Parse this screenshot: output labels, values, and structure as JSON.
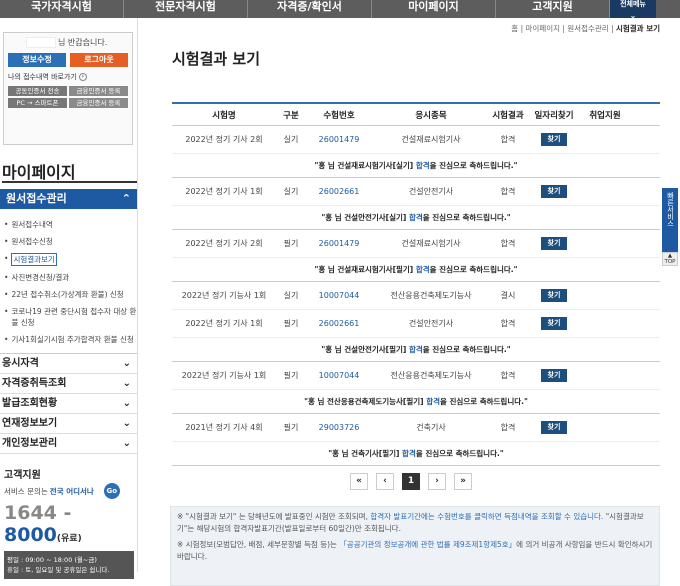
{
  "topnav": [
    "국가자격시험",
    "전문자격시험",
    "자격증/확인서",
    "마이페이지",
    "고객지원",
    "전체메뉴"
  ],
  "login": {
    "greeting": "님 반갑습니다.",
    "edit": "정보수정",
    "logout": "로그아웃",
    "shortcut": "나의 접수내역 바로가기",
    "btn1": "공동인증서 전송",
    "btn2": "금융인증서 등록",
    "btn3": "PC → 스마트폰",
    "btn4": "금융인증서 등록"
  },
  "sidebar": {
    "title": "마이페이지",
    "section": "원서접수관리",
    "items": [
      "원서접수내역",
      "원서접수신청",
      "시험결과보기",
      "사진변경신청/결과",
      "22년 접수취소(가상계좌 환불) 신청",
      "코로나19 관련 중단시험 접수자 대상 환불 신청",
      "기사1회실기시험 추가합격자 환불 신청"
    ],
    "menus": [
      "응시자격",
      "자격증취득조회",
      "발급조회현황",
      "연재정보보기",
      "개인정보관리"
    ]
  },
  "cs": {
    "title": "고객지원",
    "sub_pre": "서비스 문의는 ",
    "sub_hl": "전국 어디서나",
    "go": "Go",
    "num_a": "1644 - ",
    "num_b": "8000",
    "num_c": "(유료)",
    "hours1": "평일 : 09:00 ~ 18:00 (월~금)",
    "hours2": "휴일 : 토, 일요일 및 공휴일은 쉽니다."
  },
  "breadcrumb": {
    "a": "홈 | 마이페이지 | 원서접수관리 | ",
    "b": "시험결과 보기"
  },
  "page_title": "시험결과 보기",
  "table": {
    "headers": [
      "시험명",
      "구분",
      "수험번호",
      "응시종목",
      "시험결과",
      "일자리찾기",
      "취업지원"
    ],
    "rows": [
      {
        "exam": "2022년 정기 기사 2회",
        "type": "실기",
        "num": "26001479",
        "subject": "건설재료시험기사",
        "result": "합격",
        "btn": "찾기",
        "msg_a": "\"홍    님 건설재료시험기사[실기] ",
        "msg_pass": "합격",
        "msg_b": "을 진심으로 축하드립니다.\""
      },
      {
        "exam": "2022년 정기 기사 1회",
        "type": "실기",
        "num": "26002661",
        "subject": "건설안전기사",
        "result": "합격",
        "btn": "찾기",
        "msg_a": "\"홍    님 건설안전기사[실기] ",
        "msg_pass": "합격",
        "msg_b": "을 진심으로 축하드립니다.\""
      },
      {
        "exam": "2022년 정기 기사 2회",
        "type": "필기",
        "num": "26001479",
        "subject": "건설재료시험기사",
        "result": "합격",
        "btn": "찾기",
        "msg_a": "\"홍    님 건설재료시험기사[필기] ",
        "msg_pass": "합격",
        "msg_b": "을 진심으로 축하드립니다.\""
      },
      {
        "exam": "2022년 정기 기능사 1회",
        "type": "실기",
        "num": "10007044",
        "subject": "전산응용건축제도기능사",
        "result": "결시",
        "btn": "찾기"
      },
      {
        "exam": "2022년 정기 기사 1회",
        "type": "필기",
        "num": "26002661",
        "subject": "건설안전기사",
        "result": "합격",
        "btn": "찾기",
        "msg_a": "\"홍    님 건설안전기사[필기] ",
        "msg_pass": "합격",
        "msg_b": "을 진심으로 축하드립니다.\""
      },
      {
        "exam": "2022년 정기 기능사 1회",
        "type": "필기",
        "num": "10007044",
        "subject": "전산응용건축제도기능사",
        "result": "합격",
        "btn": "찾기",
        "msg_a": "\"홍    님 전산응용건축제도기능사[필기] ",
        "msg_pass": "합격",
        "msg_b": "을 진심으로 축하드립니다.\""
      },
      {
        "exam": "2021년 정기 기사 4회",
        "type": "필기",
        "num": "29003726",
        "subject": "건축기사",
        "result": "합격",
        "btn": "찾기",
        "msg_a": "\"홍    님 건축기사[필기] ",
        "msg_pass": "합격",
        "msg_b": "을 진심으로 축하드립니다.\""
      }
    ]
  },
  "pager": {
    "first": "«",
    "prev": "‹",
    "cur": "1",
    "next": "›",
    "last": "»"
  },
  "notes": {
    "n1_a": "※ \"시험결과 보기\" 는 당해년도에 발표중인 시험만 조회되며, ",
    "n1_hl": "합격자 발표기간에는 수험번호를 클릭하면 득점내역을 조회할 수 있습니다.",
    "n1_b": " \"시험결과보기\"는 해당시험의 합격자발표기간(발표일로부터 60일간)만 조회됩니다.",
    "n2_a": "※ 시험정보(모범답안, 배점, 세부문항별 득점 등)는 ",
    "n2_hl": "「공공기관의 정보공개에 관한 법률 제9조제1항제5호」",
    "n2_b": "에 의거 비공개 사항임을 반드시 확인하시기 바랍니다."
  },
  "side_tabs": {
    "quick": "빠른서비스",
    "top": "TOP"
  }
}
